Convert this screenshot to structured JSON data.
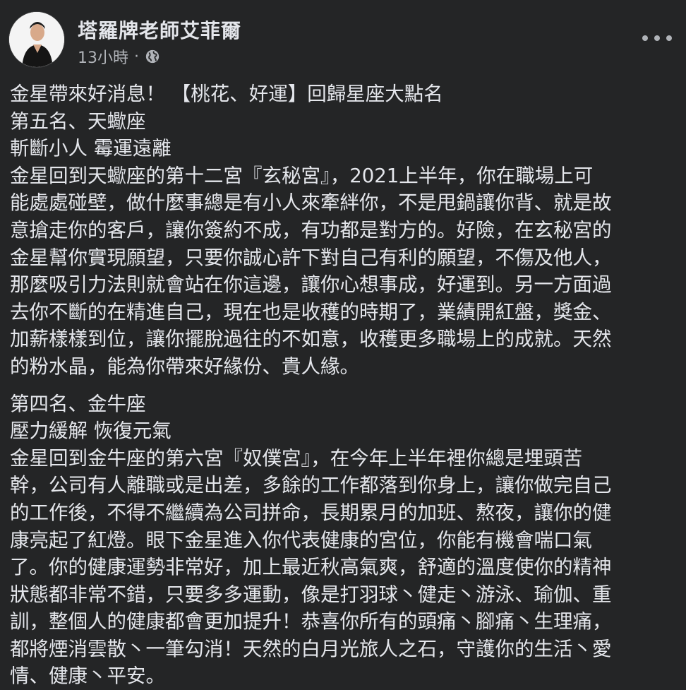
{
  "post": {
    "author": "塔羅牌老師艾菲爾",
    "time": "13小時",
    "separator": "·",
    "privacy_icon": "globe-icon",
    "more_icon": "more-options-icon"
  },
  "content": {
    "lines_1": [
      "金星帶來好消息！ 【桃花、好運】回歸星座大點名",
      "第五名、天蠍座",
      "斬斷小人 霉運遠離",
      "金星回到天蠍座的第十二宮『玄秘宮』，2021上半年，你在職場上可",
      "能處處碰壁，做什麼事總是有小人來牽絆你，不是甩鍋讓你背、就是故",
      "意搶走你的客戶，讓你簽約不成，有功都是對方的。好險，在玄秘宮的",
      "金星幫你實現願望，只要你誠心許下對自己有利的願望，不傷及他人，",
      "那麼吸引力法則就會站在你這邊，讓你心想事成，好運到。另一方面過",
      "去你不斷的在精進自己，現在也是收穫的時期了，業績開紅盤，獎金、",
      "加薪樣樣到位，讓你擺脫過往的不如意，收穫更多職場上的成就。天然",
      "的粉水晶，能為你帶來好緣份、貴人緣。"
    ],
    "lines_2": [
      "第四名、金牛座",
      "壓力緩解 恢復元氣",
      "金星回到金牛座的第六宮『奴僕宮』，在今年上半年裡你總是埋頭苦",
      "幹，公司有人離職或是出差，多餘的工作都落到你身上，讓你做完自己",
      "的工作後，不得不繼續為公司拼命，長期累月的加班、熬夜，讓你的健",
      "康亮起了紅燈。眼下金星進入你代表健康的宮位，你能有機會喘口氣",
      "了。你的健康運勢非常好，加上最近秋高氣爽，舒適的溫度使你的精神",
      "狀態都非常不錯，只要多多運動，像是打羽球丶健走丶游泳、瑜伽、重",
      "訓，整個人的健康都會更加提升！恭喜你所有的頭痛丶腳痛丶生理痛，",
      "都將煙消雲散丶一筆勾消！天然的白月光旅人之石，守護你的生活丶愛",
      "情、健康丶平安。"
    ]
  }
}
